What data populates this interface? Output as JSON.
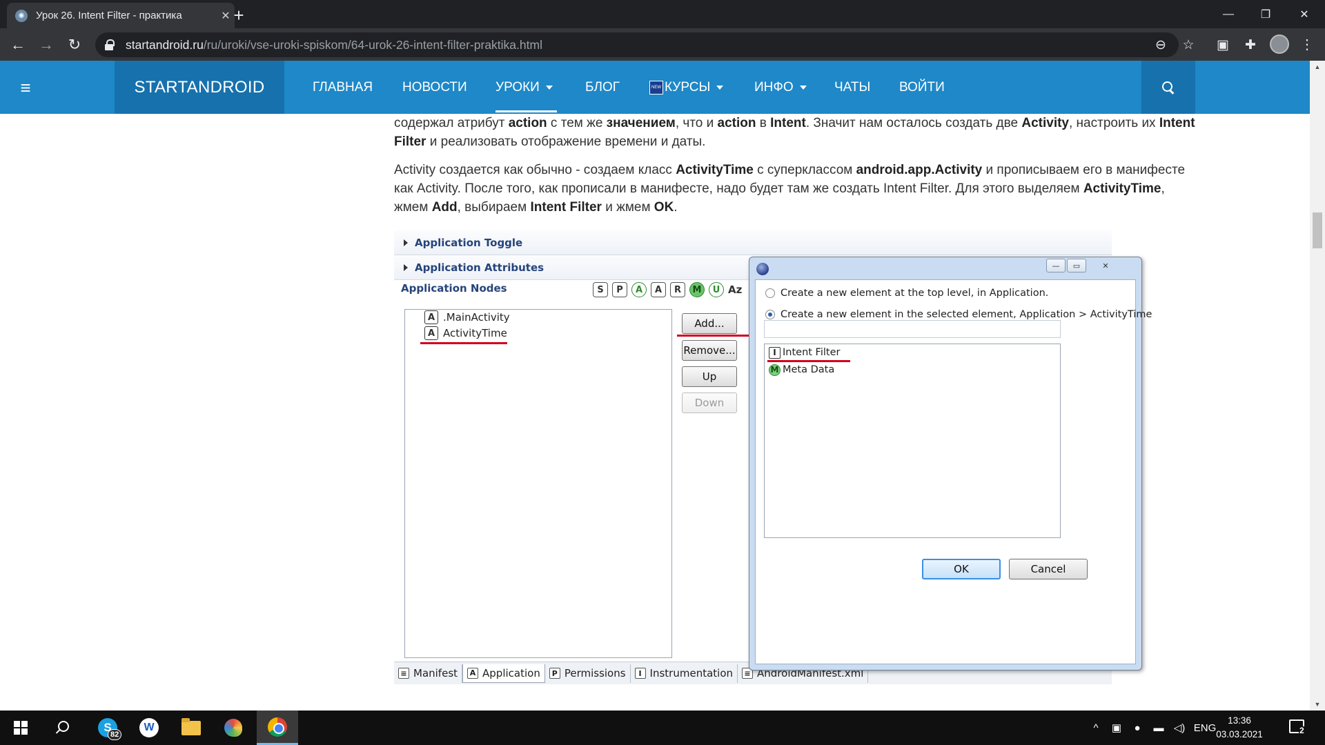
{
  "browser": {
    "tab_title": "Урок 26. Intent Filter - практика",
    "url_host": "startandroid.ru",
    "url_path": "/ru/uroki/vse-uroki-spiskom/64-urok-26-intent-filter-praktika.html",
    "new_tab": "+",
    "close_tab": "✕",
    "minimize": "—",
    "restore": "❐",
    "close_window": "✕",
    "back": "←",
    "forward": "→",
    "reload": "↻",
    "zoom_icon": "⊖",
    "star_icon": "☆",
    "ext_icon": "✚",
    "menu": "⋮"
  },
  "site_nav": {
    "brand": "STARTANDROID",
    "items": [
      {
        "label": "ГЛАВНАЯ"
      },
      {
        "label": "НОВОСТИ"
      },
      {
        "label": "УРОКИ"
      },
      {
        "label": "БЛОГ"
      },
      {
        "label": "КУРСЫ"
      },
      {
        "label": "ИНФО"
      },
      {
        "label": "ЧАТЫ"
      },
      {
        "label": "ВОЙТИ"
      }
    ],
    "new_badge": "NEW",
    "burger": "≡"
  },
  "article": {
    "p1": [
      {
        "t": "содержал атрибут "
      },
      {
        "b": "action"
      },
      {
        "t": " с тем же "
      },
      {
        "b": "значением"
      },
      {
        "t": ", что и "
      },
      {
        "b": "action"
      },
      {
        "t": " в "
      },
      {
        "b": "Intent"
      },
      {
        "t": ". Значит нам осталось создать две "
      },
      {
        "b": "Activity"
      },
      {
        "t": ", настроить их "
      },
      {
        "b": "Intent Filter"
      },
      {
        "t": " и реализовать отображение времени и даты."
      }
    ],
    "p2": [
      {
        "t": "Activity создается как обычно - создаем класс "
      },
      {
        "b": "ActivityTime"
      },
      {
        "t": " с суперклассом "
      },
      {
        "b": "android.app.Activity"
      },
      {
        "t": " и прописываем его в манифесте как Activity. После того, как прописали в манифесте, надо будет там же создать Intent Filter. Для этого выделяем "
      },
      {
        "b": "ActivityTime"
      },
      {
        "t": ", жмем "
      },
      {
        "b": "Add"
      },
      {
        "t": ", выбираем "
      },
      {
        "b": "Intent Filter"
      },
      {
        "t": " и жмем "
      },
      {
        "b": "OK"
      },
      {
        "t": "."
      }
    ]
  },
  "screenshot": {
    "section_toggle": "Application Toggle",
    "section_attributes": "Application Attributes",
    "nodes_header": "Application Nodes",
    "filter_buttons": [
      "S",
      "P",
      "A",
      "A",
      "R",
      "M",
      "U",
      "Az"
    ],
    "nodes": [
      {
        "icon": "A",
        "label": ".MainActivity"
      },
      {
        "icon": "A",
        "label": "ActivityTime"
      }
    ],
    "buttons": {
      "add": "Add...",
      "remove": "Remove...",
      "up": "Up",
      "down": "Down"
    },
    "bottom_tabs": [
      {
        "icon": "≡",
        "label": "Manifest"
      },
      {
        "icon": "A",
        "label": "Application"
      },
      {
        "icon": "P",
        "label": "Permissions"
      },
      {
        "icon": "I",
        "label": "Instrumentation"
      },
      {
        "icon": "≡",
        "label": "AndroidManifest.xml"
      }
    ],
    "dialog": {
      "radio_top": "Create a new element at the top level, in Application.",
      "radio_selected": "Create a new element in the selected element, Application > ActivityTime.",
      "items": [
        {
          "icon": "I",
          "label": "Intent Filter"
        },
        {
          "icon": "M",
          "label": "Meta Data"
        }
      ],
      "ok": "OK",
      "cancel": "Cancel",
      "min": "—",
      "max": "▭",
      "close": "✕"
    }
  },
  "taskbar": {
    "skype_letter": "S",
    "skype_badge": "82",
    "word_letter": "W",
    "language": "ENG",
    "time": "13:36",
    "date": "03.03.2021",
    "notifications": "2",
    "tray_up": "^"
  },
  "colors": {
    "nav_bg": "#1e88c8",
    "brand_bg": "#1771ad",
    "highlight_red": "#d0021b"
  }
}
